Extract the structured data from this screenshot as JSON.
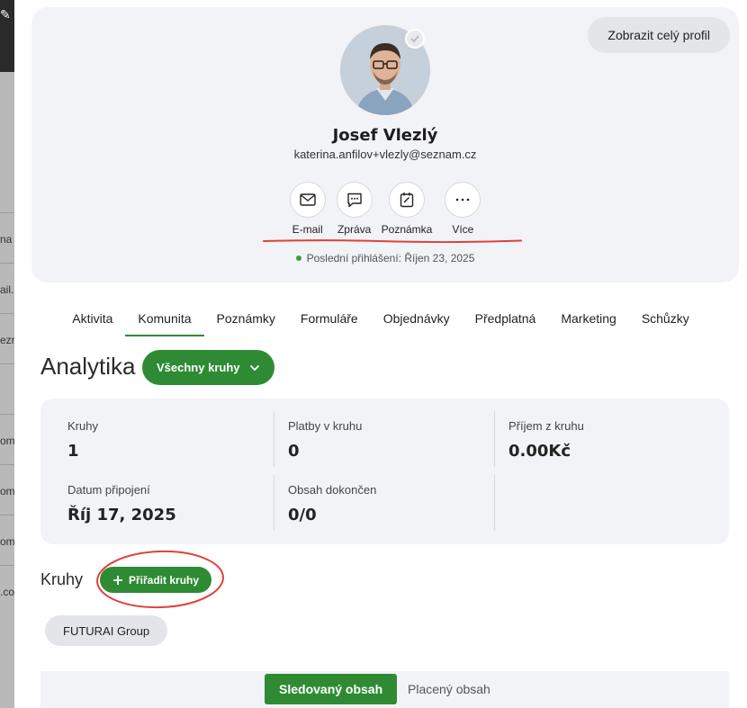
{
  "profile": {
    "full_profile_label": "Zobrazit celý profil",
    "name": "Josef Vlezlý",
    "email": "katerina.anfilov+vlezly@seznam.cz",
    "actions": [
      {
        "label": "E-mail",
        "icon": "mail-icon"
      },
      {
        "label": "Zpráva",
        "icon": "chat-icon"
      },
      {
        "label": "Poznámka",
        "icon": "note-icon"
      },
      {
        "label": "Více",
        "icon": "more-icon"
      }
    ],
    "last_login": "Poslední přihlášení: Říjen 23, 2025"
  },
  "tabs": [
    "Aktivita",
    "Komunita",
    "Poznámky",
    "Formuláře",
    "Objednávky",
    "Předplatná",
    "Marketing",
    "Schůzky"
  ],
  "active_tab": "Komunita",
  "analytics": {
    "title": "Analytika",
    "dropdown_label": "Všechny kruhy",
    "stats": {
      "circles": {
        "label": "Kruhy",
        "value": "1"
      },
      "payments": {
        "label": "Platby v kruhu",
        "value": "0"
      },
      "income": {
        "label": "Příjem z kruhu",
        "value": "0.00Kč"
      },
      "joined": {
        "label": "Datum připojení",
        "value": "Říj 17, 2025"
      },
      "content_done": {
        "label": "Obsah dokončen",
        "value": "0/0"
      }
    }
  },
  "circles": {
    "title": "Kruhy",
    "assign_label": "Přiřadit kruhy",
    "items": [
      "FUTURAI Group"
    ]
  },
  "content_tabs": {
    "followed": "Sledovaný obsah",
    "paid": "Placený obsah"
  },
  "background_fragments": [
    "na",
    "ail.",
    "ezn",
    "om",
    "om",
    "om",
    ".co"
  ],
  "colors": {
    "accent_green": "#2e8b34",
    "card_bg": "#f2f3f6",
    "annotation_red": "#e0403a"
  }
}
